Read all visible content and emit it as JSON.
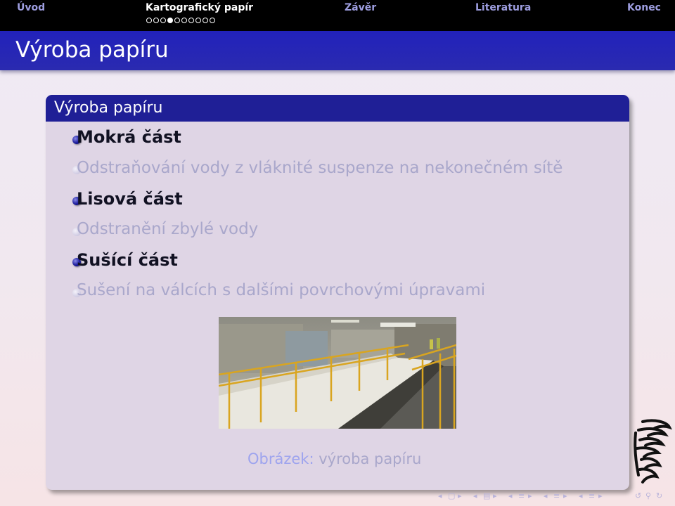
{
  "nav": {
    "sections": [
      "Úvod",
      "Kartografický papír",
      "Závěr",
      "Literatura",
      "Konec"
    ],
    "active_index": 1,
    "progress_dots": {
      "total": 10,
      "current": 4
    }
  },
  "frame": {
    "title": "Výroba papíru"
  },
  "block": {
    "title": "Výroba papíru",
    "items": [
      {
        "text": "Mokrá část",
        "level": "main"
      },
      {
        "text": "Odstraňování vody z vláknité suspenze na nekonečném sítě",
        "level": "sub"
      },
      {
        "text": "Lisová část",
        "level": "main"
      },
      {
        "text": "Odstranění zbylé vody",
        "level": "sub"
      },
      {
        "text": "Sušící část",
        "level": "main"
      },
      {
        "text": "Sušení na válcích s dalšími povrchovými úpravami",
        "level": "sub"
      }
    ]
  },
  "figure": {
    "label": "Obrázek:",
    "caption": "výroba papíru"
  },
  "colors": {
    "nav_bg": "#000000",
    "nav_inactive": "#9e9ee0",
    "title_bar": "#2222bb",
    "block_title": "#1f1f96",
    "block_body": "#dfd5e5",
    "dimmed_text": "#a9a7cb"
  },
  "icons": [
    "university-lion-logo",
    "nav-left-icon",
    "nav-right-icon",
    "nav-search-icon"
  ]
}
